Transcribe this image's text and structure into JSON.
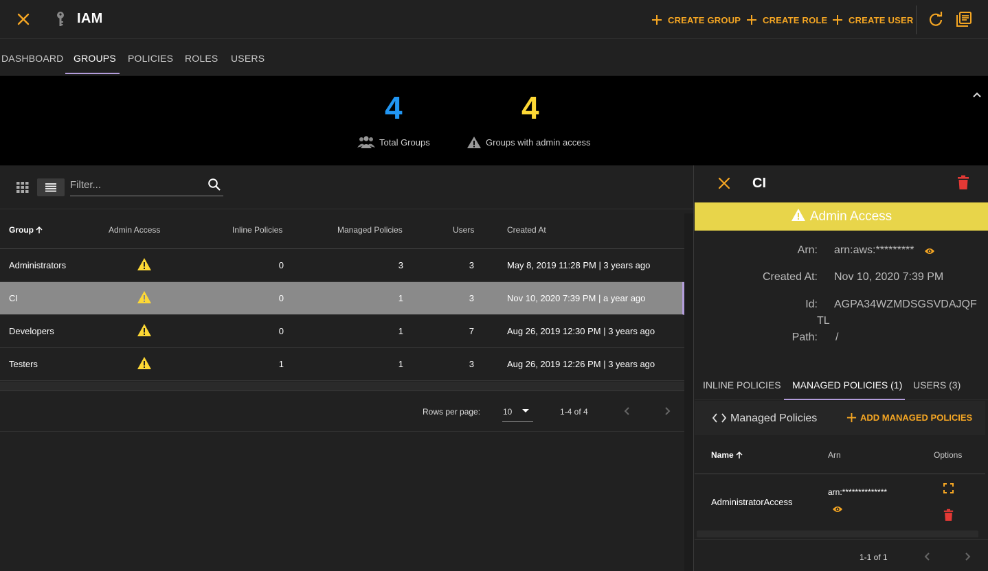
{
  "appbar": {
    "title": "IAM",
    "actions": [
      {
        "label": "CREATE GROUP"
      },
      {
        "label": "CREATE ROLE"
      },
      {
        "label": "CREATE USER"
      }
    ],
    "accent_color": "#f5a623"
  },
  "tabs": [
    {
      "label": "DASHBOARD",
      "active": false
    },
    {
      "label": "GROUPS",
      "active": true
    },
    {
      "label": "POLICIES",
      "active": false
    },
    {
      "label": "ROLES",
      "active": false
    },
    {
      "label": "USERS",
      "active": false
    }
  ],
  "stats": {
    "total_groups": {
      "value": "4",
      "label": "Total Groups",
      "color": "#2196f3"
    },
    "admin_groups": {
      "value": "4",
      "label": "Groups with admin access",
      "color": "#fdd835"
    }
  },
  "filter": {
    "placeholder": "Filter..."
  },
  "table": {
    "headers": {
      "group": "Group",
      "admin": "Admin Access",
      "inline": "Inline Policies",
      "managed": "Managed Policies",
      "users": "Users",
      "created": "Created At"
    },
    "rows": [
      {
        "group": "Administrators",
        "inline": "0",
        "managed": "3",
        "users": "3",
        "created": "May 8, 2019 11:28 PM | 3 years ago",
        "selected": false
      },
      {
        "group": "CI",
        "inline": "0",
        "managed": "1",
        "users": "3",
        "created": "Nov 10, 2020 7:39 PM | a year ago",
        "selected": true
      },
      {
        "group": "Developers",
        "inline": "0",
        "managed": "1",
        "users": "7",
        "created": "Aug 26, 2019 12:30 PM | 3 years ago",
        "selected": false
      },
      {
        "group": "Testers",
        "inline": "1",
        "managed": "1",
        "users": "3",
        "created": "Aug 26, 2019 12:26 PM | 3 years ago",
        "selected": false
      }
    ]
  },
  "pagination": {
    "rows_per_page_label": "Rows per page:",
    "rows_per_page": "10",
    "range": "1-4 of 4"
  },
  "detail": {
    "title": "CI",
    "admin_banner": "Admin Access",
    "fields": {
      "arn_label": "Arn:",
      "arn_value": "arn:aws:*********",
      "created_label": "Created At:",
      "created_value": "Nov 10, 2020 7:39 PM",
      "id_label": "Id:",
      "id_value": "AGPA34WZMDSGSVDAJQF",
      "id_wrap": "TL",
      "path_label": "Path:",
      "path_value": "/"
    },
    "tabs": [
      {
        "label": "INLINE POLICIES",
        "active": false
      },
      {
        "label": "MANAGED POLICIES (1)",
        "active": true
      },
      {
        "label": "USERS (3)",
        "active": false
      }
    ],
    "managed": {
      "section_label": "Managed Policies",
      "add_label": "ADD MANAGED POLICIES",
      "headers": {
        "name": "Name",
        "arn": "Arn",
        "options": "Options"
      },
      "rows": [
        {
          "name": "AdministratorAccess",
          "arn": "arn:**************"
        }
      ],
      "range": "1-1 of 1"
    }
  }
}
